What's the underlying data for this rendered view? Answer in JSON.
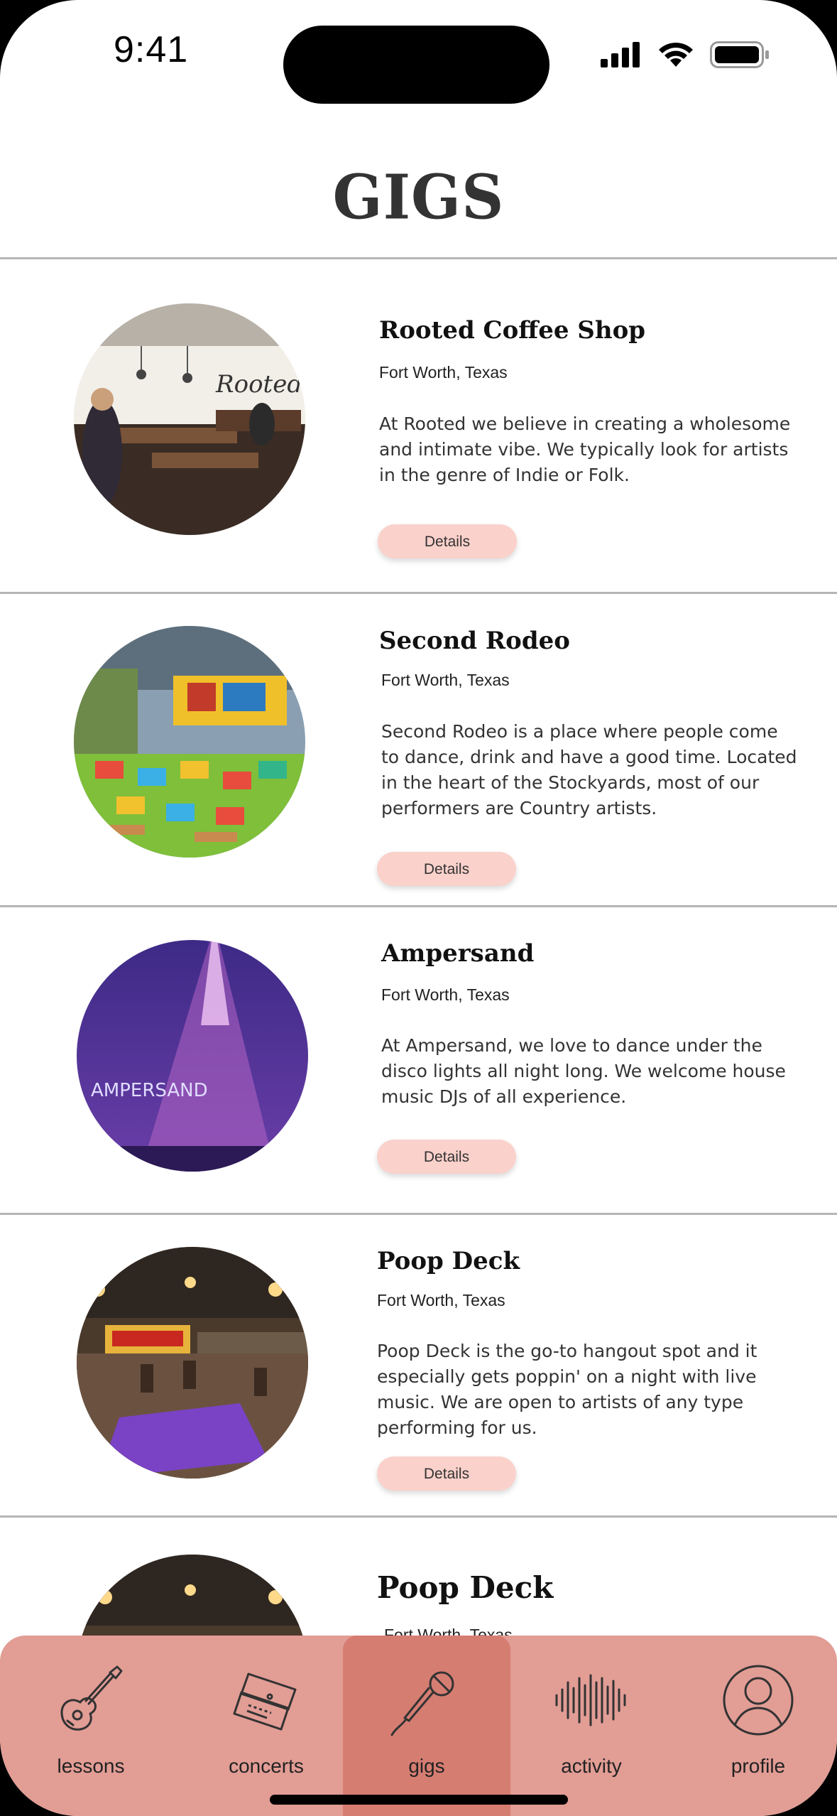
{
  "status_bar": {
    "time": "9:41"
  },
  "header": {
    "title": "GIGS"
  },
  "gigs": [
    {
      "name": "Rooted Coffee Shop",
      "location": "Fort Worth, Texas",
      "description": "At Rooted we believe in creating a wholesome and intimate vibe. We typically look for artists in the genre of Indie or Folk.",
      "button": "Details",
      "photo_sign": "Rooted"
    },
    {
      "name": "Second Rodeo",
      "location": "Fort Worth, Texas",
      "description": "Second Rodeo is a place where people come to dance, drink and have a good time. Located in the heart of the Stockyards, most of our performers are Country artists.",
      "button": "Details"
    },
    {
      "name": "Ampersand",
      "location": "Fort Worth, Texas",
      "description": "At Ampersand, we love to dance under the disco lights all night long. We welcome house music DJs of all experience.",
      "button": "Details",
      "photo_sign": "AMPERSAND"
    },
    {
      "name": "Poop Deck",
      "location": "Fort Worth, Texas",
      "description": "Poop Deck is the go-to hangout spot and it especially gets poppin' on a night with live music. We are open to artists of any type performing for us.",
      "button": "Details"
    },
    {
      "name": "Poop Deck",
      "location": "Fort Worth, Texas"
    }
  ],
  "tab_bar": {
    "active": "gigs",
    "tabs": [
      {
        "label": "lessons",
        "icon": "guitar-icon"
      },
      {
        "label": "concerts",
        "icon": "tickets-icon"
      },
      {
        "label": "gigs",
        "icon": "microphone-icon"
      },
      {
        "label": "activity",
        "icon": "soundwave-icon"
      },
      {
        "label": "profile",
        "icon": "user-icon"
      }
    ]
  },
  "colors": {
    "tab_bar": "#e29d95",
    "tab_active": "#d67d72",
    "details_button": "#fbd1cb",
    "title": "#333333"
  }
}
